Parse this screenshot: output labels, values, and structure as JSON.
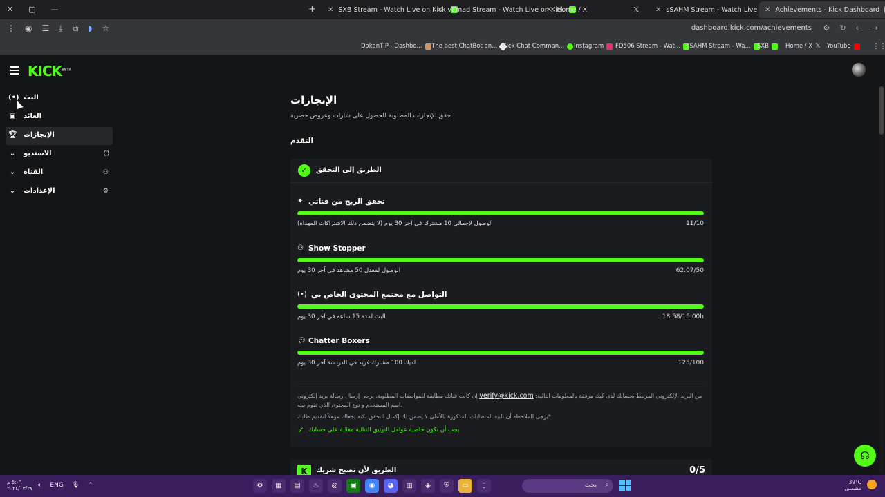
{
  "browser": {
    "tabs": [
      {
        "title": "SXB Stream - Watch Live on Kick",
        "fav_color": "#53fc18"
      },
      {
        "title": "vEmad Stream - Watch Live on Kick",
        "fav_color": "#53fc18"
      },
      {
        "title": "Home / X",
        "fav_color": "#ffffff"
      },
      {
        "title": "sSAHM Stream - Watch Live on Kick",
        "fav_color": "#53fc18"
      },
      {
        "title": "Achievements - Kick Dashboard",
        "fav_color": "#53fc18"
      }
    ],
    "url": "dashboard.kick.com/achievements",
    "bookmarks": [
      "DokanTIP - Dashbo...",
      "The best ChatBot an...",
      "Kick Chat Comman...",
      "Instagram",
      "FD506 Stream - Wat...",
      "sSAHM Stream - Wa...",
      "SXB",
      "Home / X",
      "YouTube"
    ]
  },
  "app": {
    "logo": "KICK",
    "logo_beta": "BETA",
    "accent": "#53fc18"
  },
  "sidebar": {
    "items": [
      {
        "label": "البث",
        "icon": "broadcast-icon"
      },
      {
        "label": "العائد",
        "icon": "revenue-icon"
      },
      {
        "label": "الإنجازات",
        "icon": "trophy-icon"
      },
      {
        "label": "الاستديو",
        "icon": "studio-icon"
      },
      {
        "label": "القناة",
        "icon": "channel-icon"
      },
      {
        "label": "الإعدادات",
        "icon": "settings-icon"
      }
    ]
  },
  "page": {
    "title": "الإنجازات",
    "subtitle": "حقق الإنجازات المطلوبة للحصول على شارات وعروض حصرية",
    "progress_heading": "التقدم"
  },
  "verify_card": {
    "title": "الطريق إلى التحقق",
    "goals": [
      {
        "title": "تحقق الربح من قناتي",
        "icon": "sparkle-icon",
        "desc": "الوصول لإجمالي 10 مشترك في آخر 30 يوم (لا يتضمن ذلك الاشتراكات المهداة)",
        "value": "11/10",
        "progress": 1.0
      },
      {
        "title": "Show Stopper",
        "icon": "viewers-icon",
        "desc": "الوصول لمعدل 50 مشاهد في آخر 30 يوم",
        "value": "62.07/50",
        "progress": 1.0
      },
      {
        "title": "التواصل مع مجتمع المحتوى الخاص بي",
        "icon": "broadcast-icon",
        "desc": "البث لمدة 15 ساعة في آخر 30 يوم",
        "value": "18.58/15.00h",
        "progress": 1.0
      },
      {
        "title": "Chatter Boxers",
        "icon": "chat-icon",
        "desc": "لديك 100 مشارك فريد في الدردشة آخر 30 يوم",
        "value": "125/100",
        "progress": 1.0
      }
    ],
    "note1_a": "إن كانت قناتك مطابقة للمواصفات المطلوبة، يرجى إرسال رسالة بريد إلكتروني",
    "note1_email": "verify@kick.com",
    "note1_b": "من البريد الإلكتروني المرتبط بحسابك لدى كيك مرفقة بالمعلومات التالية: اسم المستخدم و نوع المحتوى الذي تقوم ببثه.",
    "note2": "يرجى الملاحظة أن تلبية المتطلبات المذكورة بالأعلى لا يضمن لك إكمال التحقق لكنه يجعلك مؤهلاً لتقديم طلبك*",
    "note3": "يجب أن تكون خاصية عوامل التوثيق الثنائية مفعّلة على حسابك"
  },
  "partner_card": {
    "title": "الطريق لأن تصبح شريك",
    "count": "0/5"
  },
  "taskbar": {
    "time": "٥:٠٦ م",
    "date": "٢٠٢٤/٠٣/٢٧",
    "lang": "ENG",
    "search_placeholder": "بحث",
    "temp": "39°C",
    "weather": "مشمس"
  }
}
